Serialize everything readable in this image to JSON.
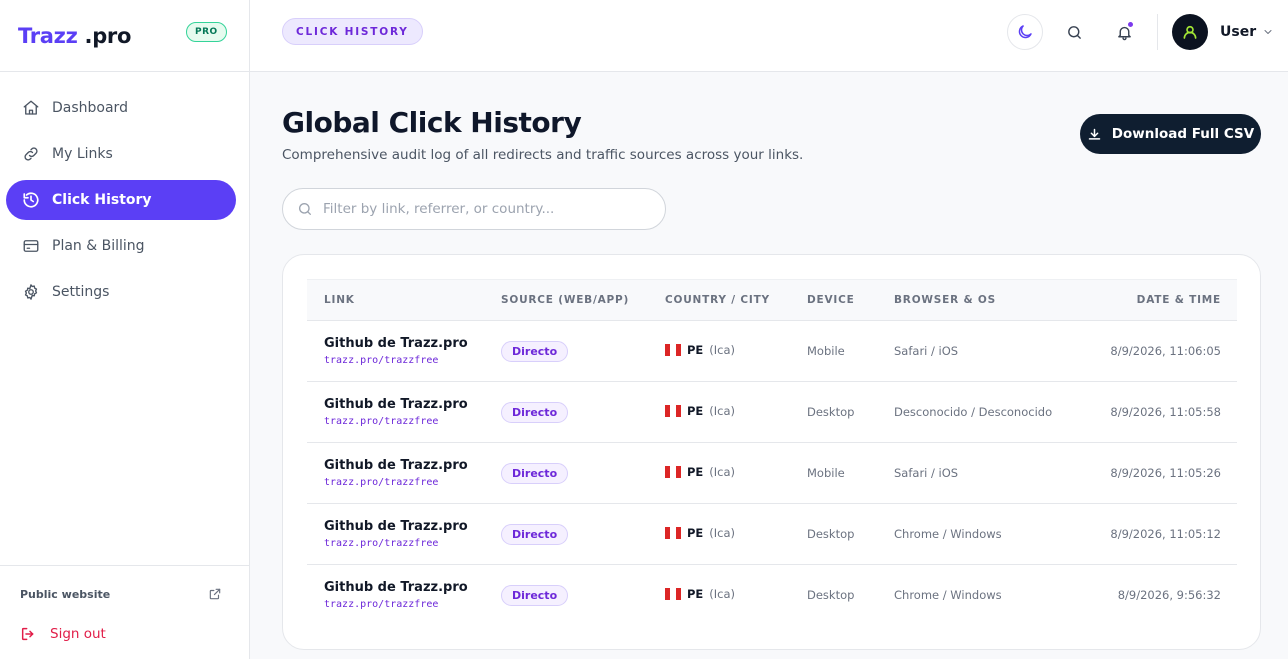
{
  "brand": {
    "name_part1": "Trazz",
    "name_part2": " .pro",
    "badge": "PRO"
  },
  "sidebar": {
    "items": [
      {
        "label": "Dashboard",
        "icon": "home-icon"
      },
      {
        "label": "My Links",
        "icon": "link-icon"
      },
      {
        "label": "Click History",
        "icon": "history-icon",
        "active": true
      },
      {
        "label": "Plan & Billing",
        "icon": "credit-card-icon"
      },
      {
        "label": "Settings",
        "icon": "gear-icon"
      }
    ],
    "public_website": "Public website",
    "sign_out": "Sign out"
  },
  "topbar": {
    "breadcrumb": "CLICK HISTORY",
    "user_name": "User"
  },
  "main": {
    "title": "Global Click History",
    "subtitle": "Comprehensive audit log of all redirects and traffic sources across your links.",
    "download_label": "Download Full CSV",
    "search_placeholder": "Filter by link, referrer, or country...",
    "search_value": ""
  },
  "table": {
    "headers": [
      "LINK",
      "SOURCE (WEB/APP)",
      "COUNTRY / CITY",
      "DEVICE",
      "BROWSER & OS",
      "DATE & TIME"
    ],
    "rows": [
      {
        "link": "Github de Trazz.pro",
        "url": "trazz.pro/trazzfree",
        "source": "Directo",
        "country": "PE",
        "city": "(Ica)",
        "device": "Mobile",
        "browser": "Safari / iOS",
        "datetime": "8/9/2026, 11:06:05"
      },
      {
        "link": "Github de Trazz.pro",
        "url": "trazz.pro/trazzfree",
        "source": "Directo",
        "country": "PE",
        "city": "(Ica)",
        "device": "Desktop",
        "browser": "Desconocido / Desconocido",
        "datetime": "8/9/2026, 11:05:58"
      },
      {
        "link": "Github de Trazz.pro",
        "url": "trazz.pro/trazzfree",
        "source": "Directo",
        "country": "PE",
        "city": "(Ica)",
        "device": "Mobile",
        "browser": "Safari / iOS",
        "datetime": "8/9/2026, 11:05:26"
      },
      {
        "link": "Github de Trazz.pro",
        "url": "trazz.pro/trazzfree",
        "source": "Directo",
        "country": "PE",
        "city": "(Ica)",
        "device": "Desktop",
        "browser": "Chrome / Windows",
        "datetime": "8/9/2026, 11:05:12"
      },
      {
        "link": "Github de Trazz.pro",
        "url": "trazz.pro/trazzfree",
        "source": "Directo",
        "country": "PE",
        "city": "(Ica)",
        "device": "Desktop",
        "browser": "Chrome / Windows",
        "datetime": "8/9/2026, 9:56:32"
      }
    ]
  },
  "colors": {
    "accent": "#5b3ff5",
    "dark_button": "#0f1e30",
    "danger": "#e11d48",
    "pro_badge": "#34d399"
  }
}
